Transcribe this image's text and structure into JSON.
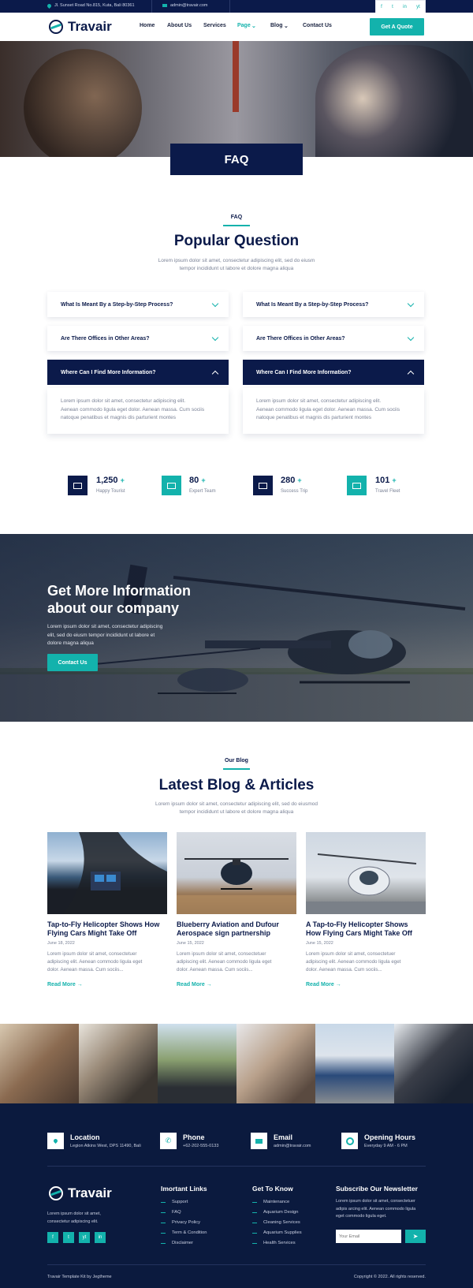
{
  "topbar": {
    "address": "Jl. Sunset Road No.815, Kuta, Bali 80361",
    "email": "admin@travair.com",
    "social": [
      "f",
      "t",
      "in",
      "yt"
    ]
  },
  "brand": {
    "name": "Travair"
  },
  "nav": {
    "items": [
      "Home",
      "About Us",
      "Services",
      "Page",
      "Blog",
      "Contact Us"
    ],
    "active": "Page",
    "cta": "Get A Quote"
  },
  "hero": {
    "title": "FAQ"
  },
  "faq_section": {
    "eyebrow": "FAQ",
    "title": "Popular Question",
    "lead_1": "Lorem ipsum dolor sit amet, consectetur adipiscing elit, sed do eiusm",
    "lead_2": "tempor incididunt ut labore et dolore magna aliqua",
    "left": [
      "What Is Meant By a Step-by-Step Process?",
      "Are There Offices in Other Areas?",
      "Where Can I Find More Information?"
    ],
    "right": [
      "What Is Meant By a Step-by-Step Process?",
      "Are There Offices in Other Areas?",
      "Where Can I Find More Information?"
    ],
    "answer_1": "Lorem ipsum dolor sit amet, consectetur adipiscing elit.",
    "answer_2": "Aenean commodo ligula eget dolor. Aenean massa. Cum sociis",
    "answer_3": "natoque penatibus et magnis dis parturient montes"
  },
  "stats": [
    {
      "value": "1,250",
      "plus": "+",
      "label": "Happy Tourist"
    },
    {
      "value": "80",
      "plus": "+",
      "label": "Expert Team"
    },
    {
      "value": "280",
      "plus": "+",
      "label": "Success Trip"
    },
    {
      "value": "101",
      "plus": "+",
      "label": "Travel Fleet"
    }
  ],
  "cta": {
    "title_1": "Get More Information",
    "title_2": "about our company",
    "text_1": "Lorem ipsum dolor sit amet, consectetur adipiscing",
    "text_2": "elit, sed do eiusm tempor incididunt ut labore et",
    "text_3": "dolore magna aliqua",
    "button": "Contact Us"
  },
  "blog": {
    "eyebrow": "Our Blog",
    "title": "Latest Blog & Articles",
    "lead_1": "Lorem ipsum dolor sit amet, consectetur adipiscing elit, sed do eiusmod",
    "lead_2": "tempor incididunt ut labore et dolore magna aliqua",
    "read_more": "Read More",
    "posts": [
      {
        "title_1": "Tap-to-Fly Helicopter Shows How",
        "title_2": "Flying Cars Might Take Off",
        "date": "June 18, 2022",
        "text_1": "Lorem ipsum dolor sit amet, consectetuer",
        "text_2": "adipiscing elit. Aenean commodo ligula eget",
        "text_3": "dolor. Aenean massa. Cum sociis..."
      },
      {
        "title_1": "Blueberry Aviation and Dufour",
        "title_2": "Aerospace sign partnership",
        "date": "June 15, 2022",
        "text_1": "Lorem ipsum dolor sit amet, consectetuer",
        "text_2": "adipiscing elit. Aenean commodo ligula eget",
        "text_3": "dolor. Aenean massa. Cum sociis..."
      },
      {
        "title_1": "A Tap-to-Fly Helicopter Shows",
        "title_2": "How Flying Cars Might Take Off",
        "date": "June 15, 2022",
        "text_1": "Lorem ipsum dolor sit amet, consectetuer",
        "text_2": "adipiscing elit. Aenean commodo ligula eget",
        "text_3": "dolor. Aenean massa. Cum sociis..."
      }
    ]
  },
  "footer": {
    "info": [
      {
        "title": "Location",
        "value": "Legion Atkins West, DPS 11490, Bali"
      },
      {
        "title": "Phone",
        "value": "+62-202-555-0133"
      },
      {
        "title": "Email",
        "value": "admin@travair.com"
      },
      {
        "title": "Opening Hours",
        "value": "Everyday 9 AM - 6 PM"
      }
    ],
    "about_1": "Lorem ipsum dolor sit amet,",
    "about_2": "consectetur adipiscing elit.",
    "social": [
      "f",
      "t",
      "yt",
      "in"
    ],
    "col1_title": "Imortant Links",
    "col1": [
      "Support",
      "FAQ",
      "Privacy Policy",
      "Term & Condition",
      "Disclaimer"
    ],
    "col2_title": "Get To Know",
    "col2": [
      "Maintenance",
      "Aquarium Design",
      "Cleaning Services",
      "Aquarium Supplies",
      "Health Services"
    ],
    "newsletter_title": "Subscribe Our Newsletter",
    "newsletter_1": "Lorem ipsum dolor sit amet, consectetuer",
    "newsletter_2": "adipis arcing elit. Aenean commodo ligula",
    "newsletter_3": "eget commodo ligula eget.",
    "newsletter_placeholder": "Your Email",
    "credit": "Travair Template Kit by Jegtheme",
    "copyright": "Copyright © 2022. All rights reserved."
  }
}
